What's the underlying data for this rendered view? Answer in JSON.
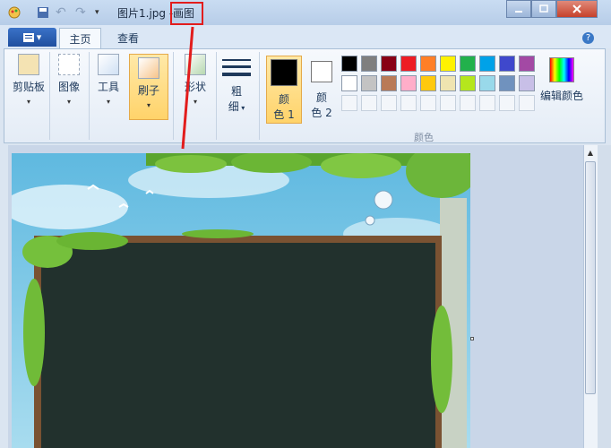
{
  "window": {
    "file_title": "图片1.jpg",
    "app_name": "画图",
    "dash": "-"
  },
  "tabs": {
    "file_menu": "▾",
    "home": "主页",
    "view": "查看"
  },
  "ribbon": {
    "clipboard": "剪贴板",
    "image": "图像",
    "tools": "工具",
    "brushes": "刷子",
    "shapes": "形状",
    "size_line1": "粗",
    "size_line2": "细",
    "color1_line1": "颜",
    "color1_line2": "色 1",
    "color2_line1": "颜",
    "color2_line2": "色 2",
    "edit_colors": "编辑颜色",
    "colors_group": "颜色"
  },
  "palette_row1": [
    "#000000",
    "#7f7f7f",
    "#880015",
    "#ed1c24",
    "#ff7f27",
    "#fff200",
    "#22b14c",
    "#00a2e8",
    "#3f48cc",
    "#a349a4"
  ],
  "palette_row2": [
    "#ffffff",
    "#c3c3c3",
    "#b97a57",
    "#ffaec9",
    "#ffc90e",
    "#efe4b0",
    "#b5e61d",
    "#99d9ea",
    "#7092be",
    "#c8bfe7"
  ],
  "accent": "#e21c1c"
}
